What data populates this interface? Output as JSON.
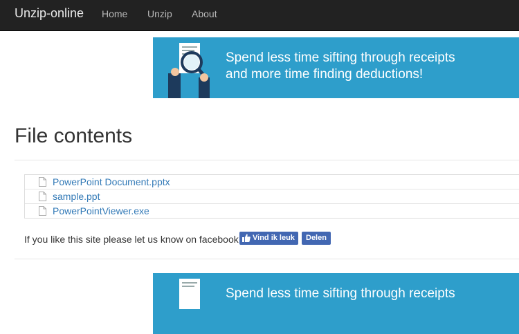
{
  "navbar": {
    "brand": "Unzip-online",
    "links": [
      "Home",
      "Unzip",
      "About"
    ]
  },
  "ad": {
    "line1": "Spend less time sifting through receipts",
    "line2": "and more time finding deductions!",
    "bottom_line1": "Spend less time sifting through receipts",
    "color": "#2e9ecb"
  },
  "main": {
    "title": "File contents",
    "files": [
      "PowerPoint Document.pptx",
      "sample.ppt",
      "PowerPointViewer.exe"
    ],
    "facebook_text": "If you like this site please let us know on facebook!",
    "like_label": "Vind ik leuk",
    "share_label": "Delen"
  },
  "colors": {
    "navbar": "#222222",
    "link": "#337ab7",
    "facebook": "#4267b2"
  }
}
